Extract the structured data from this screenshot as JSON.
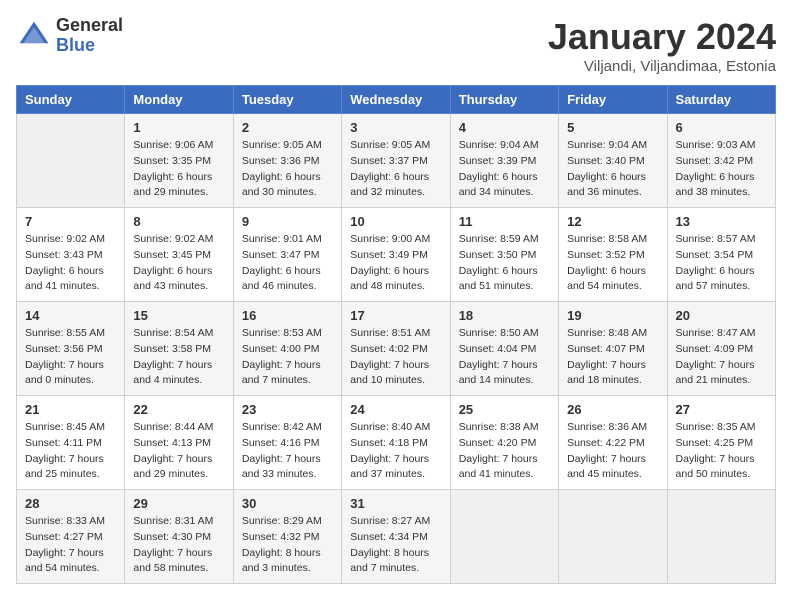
{
  "header": {
    "logo_general": "General",
    "logo_blue": "Blue",
    "title": "January 2024",
    "location": "Viljandi, Viljandimaa, Estonia"
  },
  "days_of_week": [
    "Sunday",
    "Monday",
    "Tuesday",
    "Wednesday",
    "Thursday",
    "Friday",
    "Saturday"
  ],
  "weeks": [
    [
      {
        "day": "",
        "info": ""
      },
      {
        "day": "1",
        "info": "Sunrise: 9:06 AM\nSunset: 3:35 PM\nDaylight: 6 hours\nand 29 minutes."
      },
      {
        "day": "2",
        "info": "Sunrise: 9:05 AM\nSunset: 3:36 PM\nDaylight: 6 hours\nand 30 minutes."
      },
      {
        "day": "3",
        "info": "Sunrise: 9:05 AM\nSunset: 3:37 PM\nDaylight: 6 hours\nand 32 minutes."
      },
      {
        "day": "4",
        "info": "Sunrise: 9:04 AM\nSunset: 3:39 PM\nDaylight: 6 hours\nand 34 minutes."
      },
      {
        "day": "5",
        "info": "Sunrise: 9:04 AM\nSunset: 3:40 PM\nDaylight: 6 hours\nand 36 minutes."
      },
      {
        "day": "6",
        "info": "Sunrise: 9:03 AM\nSunset: 3:42 PM\nDaylight: 6 hours\nand 38 minutes."
      }
    ],
    [
      {
        "day": "7",
        "info": "Sunrise: 9:02 AM\nSunset: 3:43 PM\nDaylight: 6 hours\nand 41 minutes."
      },
      {
        "day": "8",
        "info": "Sunrise: 9:02 AM\nSunset: 3:45 PM\nDaylight: 6 hours\nand 43 minutes."
      },
      {
        "day": "9",
        "info": "Sunrise: 9:01 AM\nSunset: 3:47 PM\nDaylight: 6 hours\nand 46 minutes."
      },
      {
        "day": "10",
        "info": "Sunrise: 9:00 AM\nSunset: 3:49 PM\nDaylight: 6 hours\nand 48 minutes."
      },
      {
        "day": "11",
        "info": "Sunrise: 8:59 AM\nSunset: 3:50 PM\nDaylight: 6 hours\nand 51 minutes."
      },
      {
        "day": "12",
        "info": "Sunrise: 8:58 AM\nSunset: 3:52 PM\nDaylight: 6 hours\nand 54 minutes."
      },
      {
        "day": "13",
        "info": "Sunrise: 8:57 AM\nSunset: 3:54 PM\nDaylight: 6 hours\nand 57 minutes."
      }
    ],
    [
      {
        "day": "14",
        "info": "Sunrise: 8:55 AM\nSunset: 3:56 PM\nDaylight: 7 hours\nand 0 minutes."
      },
      {
        "day": "15",
        "info": "Sunrise: 8:54 AM\nSunset: 3:58 PM\nDaylight: 7 hours\nand 4 minutes."
      },
      {
        "day": "16",
        "info": "Sunrise: 8:53 AM\nSunset: 4:00 PM\nDaylight: 7 hours\nand 7 minutes."
      },
      {
        "day": "17",
        "info": "Sunrise: 8:51 AM\nSunset: 4:02 PM\nDaylight: 7 hours\nand 10 minutes."
      },
      {
        "day": "18",
        "info": "Sunrise: 8:50 AM\nSunset: 4:04 PM\nDaylight: 7 hours\nand 14 minutes."
      },
      {
        "day": "19",
        "info": "Sunrise: 8:48 AM\nSunset: 4:07 PM\nDaylight: 7 hours\nand 18 minutes."
      },
      {
        "day": "20",
        "info": "Sunrise: 8:47 AM\nSunset: 4:09 PM\nDaylight: 7 hours\nand 21 minutes."
      }
    ],
    [
      {
        "day": "21",
        "info": "Sunrise: 8:45 AM\nSunset: 4:11 PM\nDaylight: 7 hours\nand 25 minutes."
      },
      {
        "day": "22",
        "info": "Sunrise: 8:44 AM\nSunset: 4:13 PM\nDaylight: 7 hours\nand 29 minutes."
      },
      {
        "day": "23",
        "info": "Sunrise: 8:42 AM\nSunset: 4:16 PM\nDaylight: 7 hours\nand 33 minutes."
      },
      {
        "day": "24",
        "info": "Sunrise: 8:40 AM\nSunset: 4:18 PM\nDaylight: 7 hours\nand 37 minutes."
      },
      {
        "day": "25",
        "info": "Sunrise: 8:38 AM\nSunset: 4:20 PM\nDaylight: 7 hours\nand 41 minutes."
      },
      {
        "day": "26",
        "info": "Sunrise: 8:36 AM\nSunset: 4:22 PM\nDaylight: 7 hours\nand 45 minutes."
      },
      {
        "day": "27",
        "info": "Sunrise: 8:35 AM\nSunset: 4:25 PM\nDaylight: 7 hours\nand 50 minutes."
      }
    ],
    [
      {
        "day": "28",
        "info": "Sunrise: 8:33 AM\nSunset: 4:27 PM\nDaylight: 7 hours\nand 54 minutes."
      },
      {
        "day": "29",
        "info": "Sunrise: 8:31 AM\nSunset: 4:30 PM\nDaylight: 7 hours\nand 58 minutes."
      },
      {
        "day": "30",
        "info": "Sunrise: 8:29 AM\nSunset: 4:32 PM\nDaylight: 8 hours\nand 3 minutes."
      },
      {
        "day": "31",
        "info": "Sunrise: 8:27 AM\nSunset: 4:34 PM\nDaylight: 8 hours\nand 7 minutes."
      },
      {
        "day": "",
        "info": ""
      },
      {
        "day": "",
        "info": ""
      },
      {
        "day": "",
        "info": ""
      }
    ]
  ]
}
